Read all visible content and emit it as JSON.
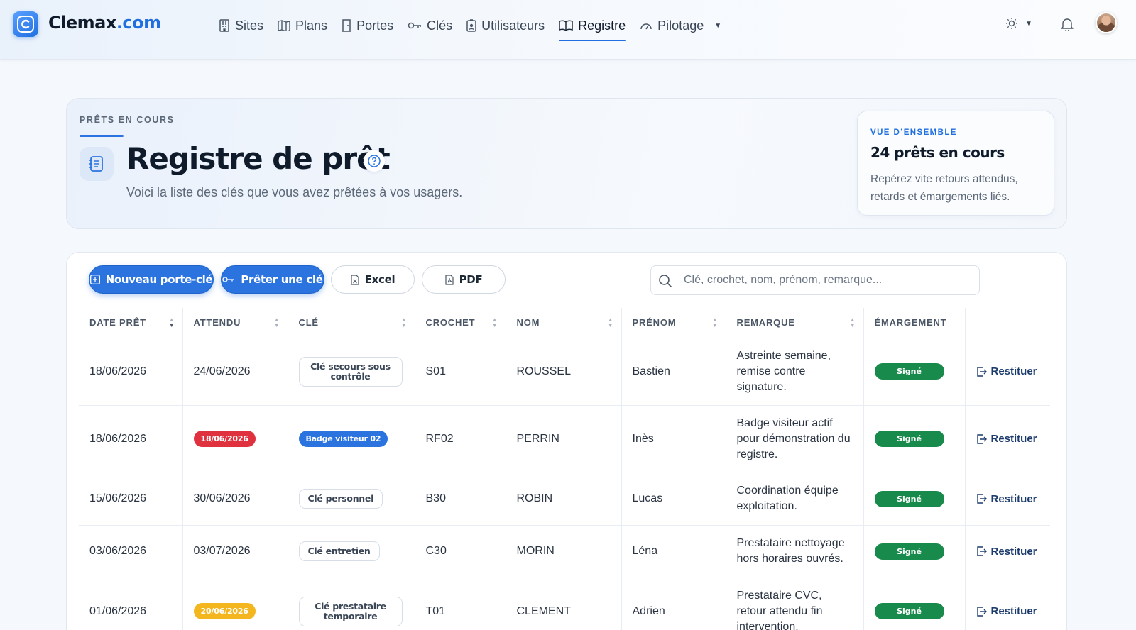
{
  "brand": {
    "name": "Clemax",
    "domain": ".com"
  },
  "nav": [
    {
      "label": "Sites",
      "icon": "building-icon"
    },
    {
      "label": "Plans",
      "icon": "map-icon"
    },
    {
      "label": "Portes",
      "icon": "door-icon"
    },
    {
      "label": "Clés",
      "icon": "key-icon"
    },
    {
      "label": "Utilisateurs",
      "icon": "badge-icon"
    },
    {
      "label": "Registre",
      "icon": "book-icon",
      "active": true
    },
    {
      "label": "Pilotage",
      "icon": "gauge-icon"
    }
  ],
  "hero": {
    "eyebrow": "PRÊTS EN COURS",
    "title": "Registre de prêt",
    "subtitle": "Voici la liste des clés que vous avez prêtées à vos usagers."
  },
  "overview": {
    "eyebrow": "VUE D’ENSEMBLE",
    "title": "24 prêts en cours",
    "text": "Repérez vite retours attendus, retards et émargements liés."
  },
  "toolbar": {
    "new_keyring": "Nouveau porte-clé",
    "lend_key": "Prêter une clé",
    "excel": "Excel",
    "pdf": "PDF",
    "search_placeholder": "Clé, crochet, nom, prénom, remarque..."
  },
  "table": {
    "headers": [
      "DATE PRÊT",
      "ATTENDU",
      "CLÉ",
      "CROCHET",
      "NOM",
      "PRÉNOM",
      "REMARQUE",
      "ÉMARGEMENT"
    ],
    "rows": [
      {
        "date": "18/06/2026",
        "expected": "24/06/2026",
        "expected_status": "normal",
        "key": "Clé secours sous contrôle",
        "key_style": "tag",
        "hook": "S01",
        "name": "ROUSSEL",
        "first": "Bastien",
        "remark": "Astreinte semaine, remise contre signature.",
        "signature": "Signé",
        "action": "Restituer"
      },
      {
        "date": "18/06/2026",
        "expected": "18/06/2026",
        "expected_status": "late",
        "key": "Badge visiteur 02",
        "key_style": "badge",
        "hook": "RF02",
        "name": "PERRIN",
        "first": "Inès",
        "remark": "Badge visiteur actif pour démonstration du registre.",
        "signature": "Signé",
        "action": "Restituer"
      },
      {
        "date": "15/06/2026",
        "expected": "30/06/2026",
        "expected_status": "normal",
        "key": "Clé personnel",
        "key_style": "tag",
        "hook": "B30",
        "name": "ROBIN",
        "first": "Lucas",
        "remark": "Coordination équipe exploitation.",
        "signature": "Signé",
        "action": "Restituer"
      },
      {
        "date": "03/06/2026",
        "expected": "03/07/2026",
        "expected_status": "normal",
        "key": "Clé entretien",
        "key_style": "tag",
        "hook": "C30",
        "name": "MORIN",
        "first": "Léna",
        "remark": "Prestataire nettoyage hors horaires ouvrés.",
        "signature": "Signé",
        "action": "Restituer"
      },
      {
        "date": "01/06/2026",
        "expected": "20/06/2026",
        "expected_status": "soon",
        "key": "Clé prestataire temporaire",
        "key_style": "tag",
        "hook": "T01",
        "name": "CLEMENT",
        "first": "Adrien",
        "remark": "Prestataire CVC, retour attendu fin intervention.",
        "signature": "Signé",
        "action": "Restituer"
      }
    ]
  },
  "colors": {
    "accent": "#2b74e0",
    "late": "#e0313f",
    "soon": "#f3b61f",
    "signed": "#188a4b"
  }
}
